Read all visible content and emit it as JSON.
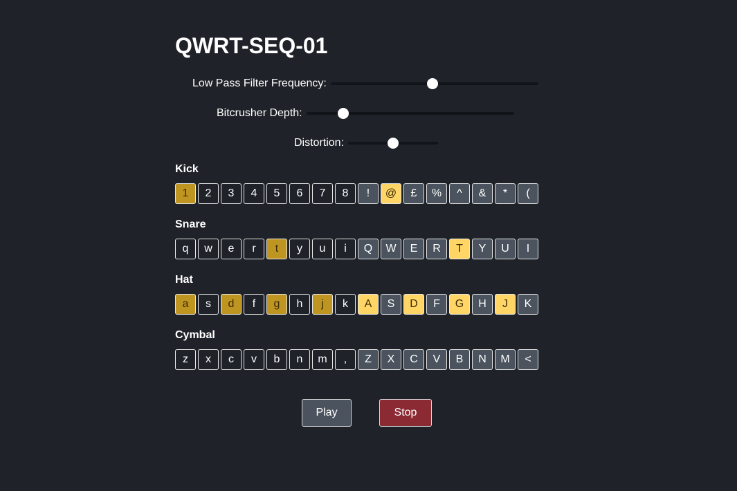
{
  "title": "QWRT-SEQ-01",
  "controls": {
    "lowpass": {
      "label": "Low Pass Filter Frequency:",
      "value": 0.49
    },
    "bitcrusher": {
      "label": "Bitcrusher Depth:",
      "value": 0.16
    },
    "distortion": {
      "label": "Distortion:",
      "value": 0.5
    }
  },
  "tracks": [
    {
      "name": "Kick",
      "keys": [
        "1",
        "2",
        "3",
        "4",
        "5",
        "6",
        "7",
        "8",
        "!",
        "@",
        "£",
        "%",
        "^",
        "&",
        "*",
        "("
      ],
      "active": [
        true,
        false,
        false,
        false,
        false,
        false,
        false,
        false,
        false,
        true,
        false,
        false,
        false,
        false,
        false,
        false
      ]
    },
    {
      "name": "Snare",
      "keys": [
        "q",
        "w",
        "e",
        "r",
        "t",
        "y",
        "u",
        "i",
        "Q",
        "W",
        "E",
        "R",
        "T",
        "Y",
        "U",
        "I"
      ],
      "active": [
        false,
        false,
        false,
        false,
        true,
        false,
        false,
        false,
        false,
        false,
        false,
        false,
        true,
        false,
        false,
        false
      ]
    },
    {
      "name": "Hat",
      "keys": [
        "a",
        "s",
        "d",
        "f",
        "g",
        "h",
        "j",
        "k",
        "A",
        "S",
        "D",
        "F",
        "G",
        "H",
        "J",
        "K"
      ],
      "active": [
        true,
        false,
        true,
        false,
        true,
        false,
        true,
        false,
        true,
        false,
        true,
        false,
        true,
        false,
        true,
        false
      ]
    },
    {
      "name": "Cymbal",
      "keys": [
        "z",
        "x",
        "c",
        "v",
        "b",
        "n",
        "m",
        ",",
        "Z",
        "X",
        "C",
        "V",
        "B",
        "N",
        "M",
        "<"
      ],
      "active": [
        false,
        false,
        false,
        false,
        false,
        false,
        false,
        false,
        false,
        false,
        false,
        false,
        false,
        false,
        false,
        false
      ]
    }
  ],
  "buttons": {
    "play": "Play",
    "stop": "Stop"
  },
  "colors": {
    "background": "#1f2329",
    "pad_upper": "#4b545e",
    "active_lower": "#bf9521",
    "active_upper": "#ffd666",
    "play_button": "#4b545e",
    "stop_button": "#8c2a33",
    "slider_track": "#111418"
  }
}
